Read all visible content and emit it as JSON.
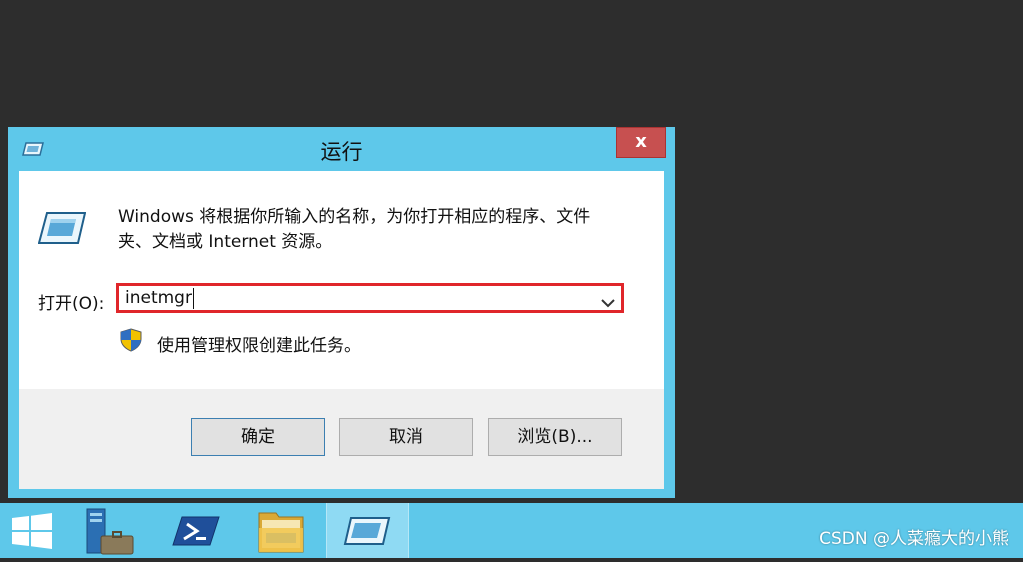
{
  "dialog": {
    "title": "运行",
    "close_label": "x",
    "description_line1": "Windows 将根据你所输入的名称，为你打开相应的程序、文件",
    "description_line2": "夹、文档或 Internet 资源。",
    "open_label": "打开(O):",
    "input_value": "inetmgr",
    "admin_note": "使用管理权限创建此任务。",
    "ok_label": "确定",
    "cancel_label": "取消",
    "browse_label": "浏览(B)..."
  },
  "taskbar": {
    "items": [
      {
        "name": "start",
        "icon": "windows-logo-icon"
      },
      {
        "name": "server-manager",
        "icon": "server-manager-icon"
      },
      {
        "name": "powershell",
        "icon": "powershell-icon"
      },
      {
        "name": "file-explorer",
        "icon": "folder-icon"
      },
      {
        "name": "run",
        "icon": "run-icon",
        "active": true
      }
    ]
  },
  "watermark": "CSDN @人菜瘾大的小熊",
  "colors": {
    "accent": "#5ec8ea",
    "close": "#c75050",
    "highlight": "#e0262a",
    "desktop": "#2d2d2d"
  }
}
